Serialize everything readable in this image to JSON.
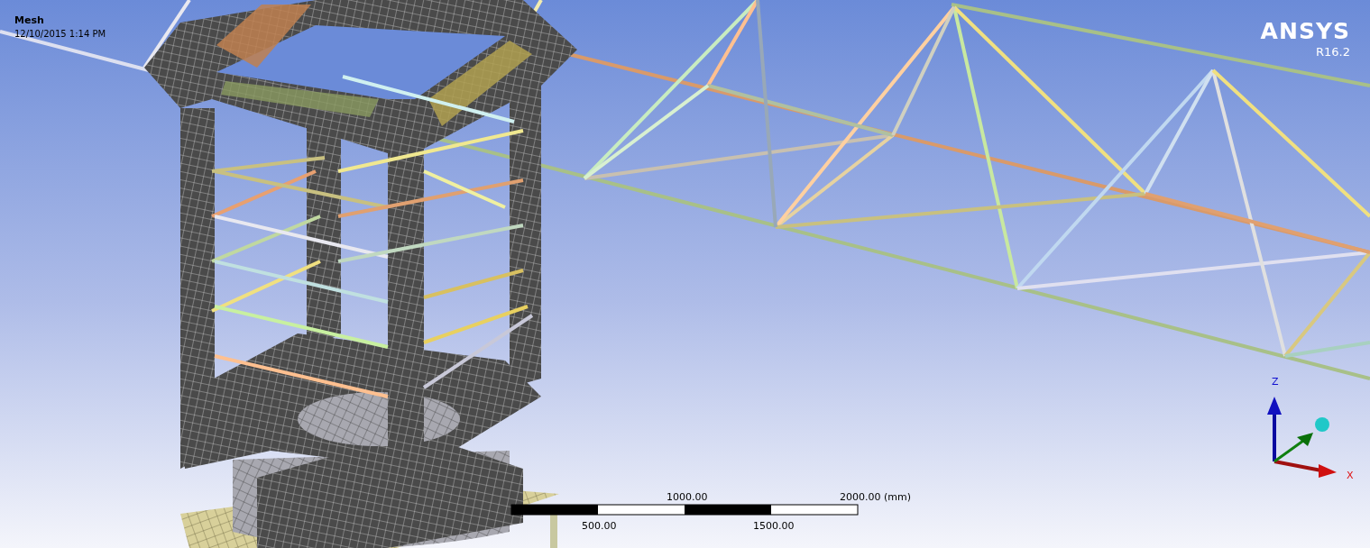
{
  "viewport": {
    "title": "Mesh",
    "timestamp": "12/10/2015 1:14 PM"
  },
  "logo": {
    "name": "ANSYS",
    "version": "R16.2"
  },
  "scale_bar": {
    "top_labels": [
      "1000.00",
      "2000.00 (mm)"
    ],
    "bottom_labels": [
      "500.00",
      "1500.00"
    ]
  },
  "triad": {
    "axes": [
      "Z",
      "X"
    ]
  }
}
